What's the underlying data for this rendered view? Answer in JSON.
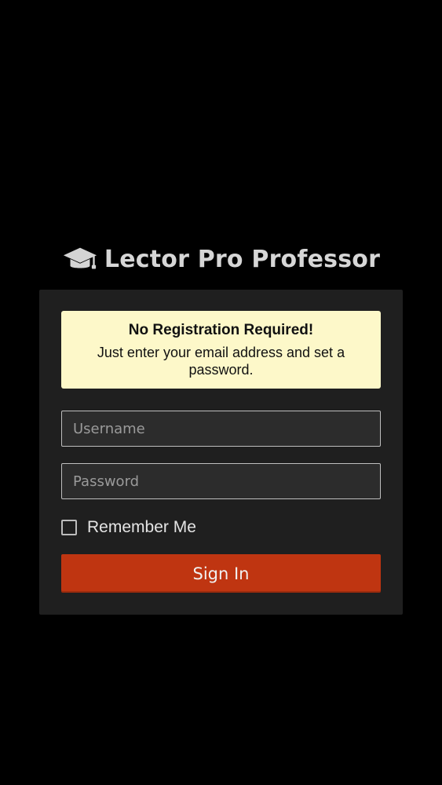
{
  "brand": {
    "icon": "graduation-cap-icon",
    "title": "Lector Pro Professor"
  },
  "notice": {
    "heading": "No Registration Required!",
    "body": "Just enter your email address and set a password."
  },
  "form": {
    "username_placeholder": "Username",
    "password_placeholder": "Password",
    "remember_label": "Remember Me",
    "remember_checked": false,
    "signin_label": "Sign In"
  },
  "colors": {
    "background": "#000000",
    "card": "#1f1f1f",
    "notice_bg": "#fdf8c9",
    "accent": "#bf3511"
  }
}
